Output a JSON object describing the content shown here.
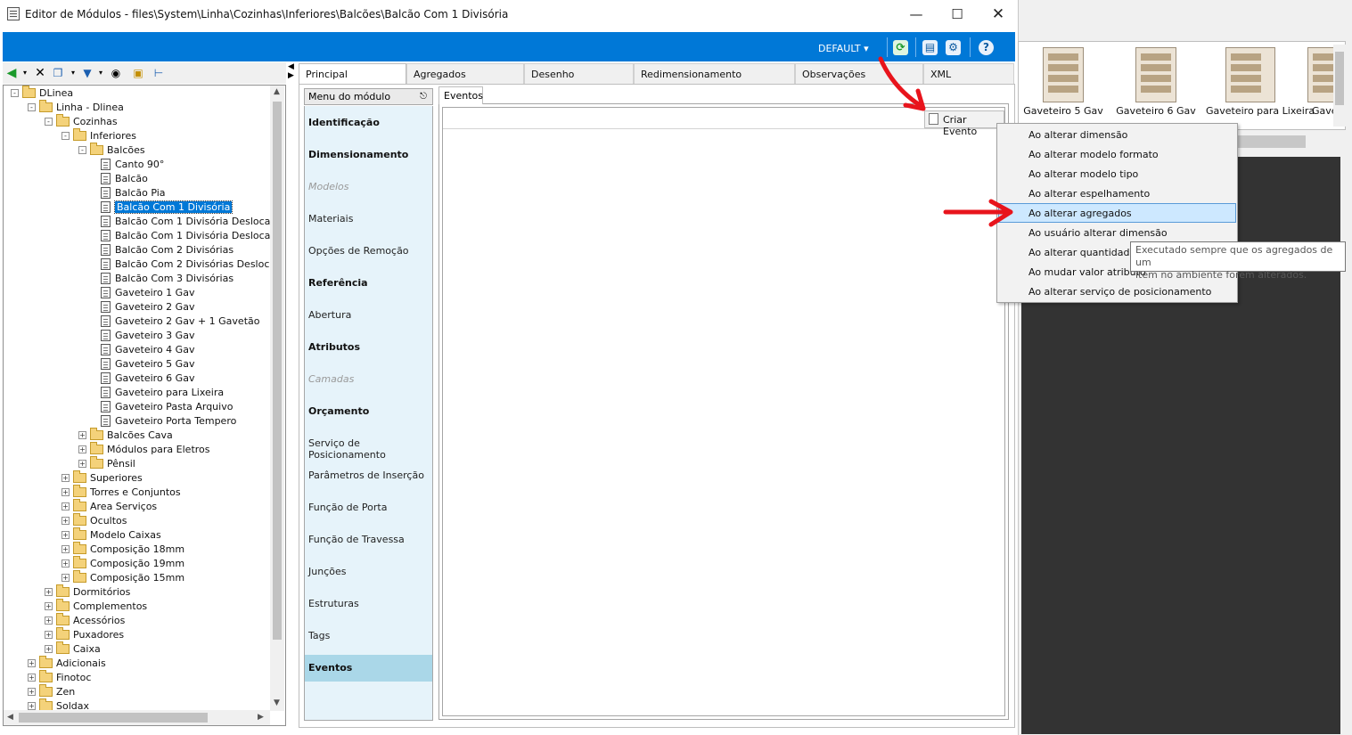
{
  "window": {
    "title": "Editor de Módulos - files\\System\\Linha\\Cozinhas\\Inferiores\\Balcões\\Balcão Com 1 Divisória"
  },
  "toolbar": {
    "profile": "DEFAULT",
    "profile_arrow": "▾"
  },
  "tree": {
    "items": [
      {
        "label": "DLinea",
        "type": "folder",
        "expander": "-",
        "indent": 0
      },
      {
        "label": "Linha - Dlinea",
        "type": "folder",
        "expander": "-",
        "indent": 1
      },
      {
        "label": "Cozinhas",
        "type": "folder",
        "expander": "-",
        "indent": 2
      },
      {
        "label": "Inferiores",
        "type": "folder",
        "expander": "-",
        "indent": 3
      },
      {
        "label": "Balcões",
        "type": "folder",
        "expander": "-",
        "indent": 4
      },
      {
        "label": "Canto 90°",
        "type": "doc",
        "indent": 5
      },
      {
        "label": "Balcão",
        "type": "doc",
        "indent": 5
      },
      {
        "label": "Balcão Pia",
        "type": "doc",
        "indent": 5
      },
      {
        "label": "Balcão Com 1 Divisória",
        "type": "doc",
        "indent": 5,
        "selected": true
      },
      {
        "label": "Balcão Com 1 Divisória Desloca",
        "type": "doc",
        "indent": 5
      },
      {
        "label": "Balcão Com 1 Divisória Desloca",
        "type": "doc",
        "indent": 5
      },
      {
        "label": "Balcão Com 2 Divisórias",
        "type": "doc",
        "indent": 5
      },
      {
        "label": "Balcão Com 2 Divisórias Desloc",
        "type": "doc",
        "indent": 5
      },
      {
        "label": "Balcão Com 3 Divisórias",
        "type": "doc",
        "indent": 5
      },
      {
        "label": "Gaveteiro 1 Gav",
        "type": "doc",
        "indent": 5
      },
      {
        "label": "Gaveteiro 2 Gav",
        "type": "doc",
        "indent": 5
      },
      {
        "label": "Gaveteiro 2 Gav + 1 Gavetão",
        "type": "doc",
        "indent": 5
      },
      {
        "label": "Gaveteiro 3 Gav",
        "type": "doc",
        "indent": 5
      },
      {
        "label": "Gaveteiro 4 Gav",
        "type": "doc",
        "indent": 5
      },
      {
        "label": "Gaveteiro 5 Gav",
        "type": "doc",
        "indent": 5
      },
      {
        "label": "Gaveteiro 6 Gav",
        "type": "doc",
        "indent": 5
      },
      {
        "label": "Gaveteiro para Lixeira",
        "type": "doc",
        "indent": 5
      },
      {
        "label": "Gaveteiro Pasta Arquivo",
        "type": "doc",
        "indent": 5
      },
      {
        "label": "Gaveteiro Porta Tempero",
        "type": "doc",
        "indent": 5
      },
      {
        "label": "Balcões Cava",
        "type": "folder",
        "expander": "+",
        "indent": 4
      },
      {
        "label": "Módulos para Eletros",
        "type": "folder",
        "expander": "+",
        "indent": 4
      },
      {
        "label": "Pênsil",
        "type": "folder",
        "expander": "+",
        "indent": 4
      },
      {
        "label": "Superiores",
        "type": "folder",
        "expander": "+",
        "indent": 3
      },
      {
        "label": "Torres e Conjuntos",
        "type": "folder",
        "expander": "+",
        "indent": 3
      },
      {
        "label": "Area Serviços",
        "type": "folder",
        "expander": "+",
        "indent": 3
      },
      {
        "label": "Ocultos",
        "type": "folder",
        "expander": "+",
        "indent": 3
      },
      {
        "label": "Modelo Caixas",
        "type": "folder",
        "expander": "+",
        "indent": 3
      },
      {
        "label": "Composição 18mm",
        "type": "folder",
        "expander": "+",
        "indent": 3
      },
      {
        "label": "Composição 19mm",
        "type": "folder",
        "expander": "+",
        "indent": 3
      },
      {
        "label": "Composição 15mm",
        "type": "folder",
        "expander": "+",
        "indent": 3
      },
      {
        "label": "Dormitórios",
        "type": "folder",
        "expander": "+",
        "indent": 2
      },
      {
        "label": "Complementos",
        "type": "folder",
        "expander": "+",
        "indent": 2
      },
      {
        "label": "Acessórios",
        "type": "folder",
        "expander": "+",
        "indent": 2
      },
      {
        "label": "Puxadores",
        "type": "folder",
        "expander": "+",
        "indent": 2
      },
      {
        "label": "Caixa",
        "type": "folder",
        "expander": "+",
        "indent": 2
      },
      {
        "label": "Adicionais",
        "type": "folder",
        "expander": "+",
        "indent": 1
      },
      {
        "label": "Finotoc",
        "type": "folder",
        "expander": "+",
        "indent": 1
      },
      {
        "label": "Zen",
        "type": "folder",
        "expander": "+",
        "indent": 1
      },
      {
        "label": "Soldax",
        "type": "folder",
        "expander": "+",
        "indent": 1
      }
    ]
  },
  "tabs": [
    {
      "label": "Principal",
      "active": true
    },
    {
      "label": "Agregados"
    },
    {
      "label": "Desenho"
    },
    {
      "label": "Redimensionamento"
    },
    {
      "label": "Observações"
    },
    {
      "label": "XML"
    }
  ],
  "module_menu": {
    "header": "Menu do módulo",
    "items": [
      {
        "label": "Identificação",
        "style": "bold"
      },
      {
        "label": "Dimensionamento",
        "style": "bold"
      },
      {
        "label": "Modelos",
        "style": "disabled"
      },
      {
        "label": "Materiais",
        "style": "normal"
      },
      {
        "label": "Opções de Remoção",
        "style": "normal"
      },
      {
        "label": "Referência",
        "style": "bold"
      },
      {
        "label": "Abertura",
        "style": "normal"
      },
      {
        "label": "Atributos",
        "style": "bold"
      },
      {
        "label": "Camadas",
        "style": "disabled"
      },
      {
        "label": "Orçamento",
        "style": "bold"
      },
      {
        "label": "Serviço de Posicionamento",
        "style": "normal"
      },
      {
        "label": "Parâmetros de Inserção",
        "style": "normal"
      },
      {
        "label": "Função de Porta",
        "style": "normal"
      },
      {
        "label": "Função de Travessa",
        "style": "normal"
      },
      {
        "label": "Junções",
        "style": "normal"
      },
      {
        "label": "Estruturas",
        "style": "normal"
      },
      {
        "label": "Tags",
        "style": "normal"
      },
      {
        "label": "Eventos",
        "style": "bold",
        "selected": true
      }
    ]
  },
  "events": {
    "tab_label": "Eventos",
    "create_button": "Criar Evento",
    "menu_items": [
      "Ao alterar dimensão",
      "Ao alterar modelo formato",
      "Ao alterar modelo tipo",
      "Ao alterar espelhamento",
      "Ao alterar agregados",
      "Ao usuário alterar dimensão",
      "Ao alterar quantidade",
      "Ao mudar valor atributo",
      "Ao alterar serviço de posicionamento"
    ],
    "highlighted_index": 4,
    "tooltip_line1": "Executado sempre que os agregados de um",
    "tooltip_line2": "item no ambiente forem alterados."
  },
  "gallery": {
    "items": [
      "Gaveteiro 5 Gav",
      "Gaveteiro 6 Gav",
      "Gaveteiro para Lixeira",
      "Gave"
    ]
  },
  "colors": {
    "accent": "#0078d7",
    "menu_bg": "#e6f3fa",
    "menu_selected": "#aad7e8",
    "highlight_arrow": "#e8141c"
  }
}
